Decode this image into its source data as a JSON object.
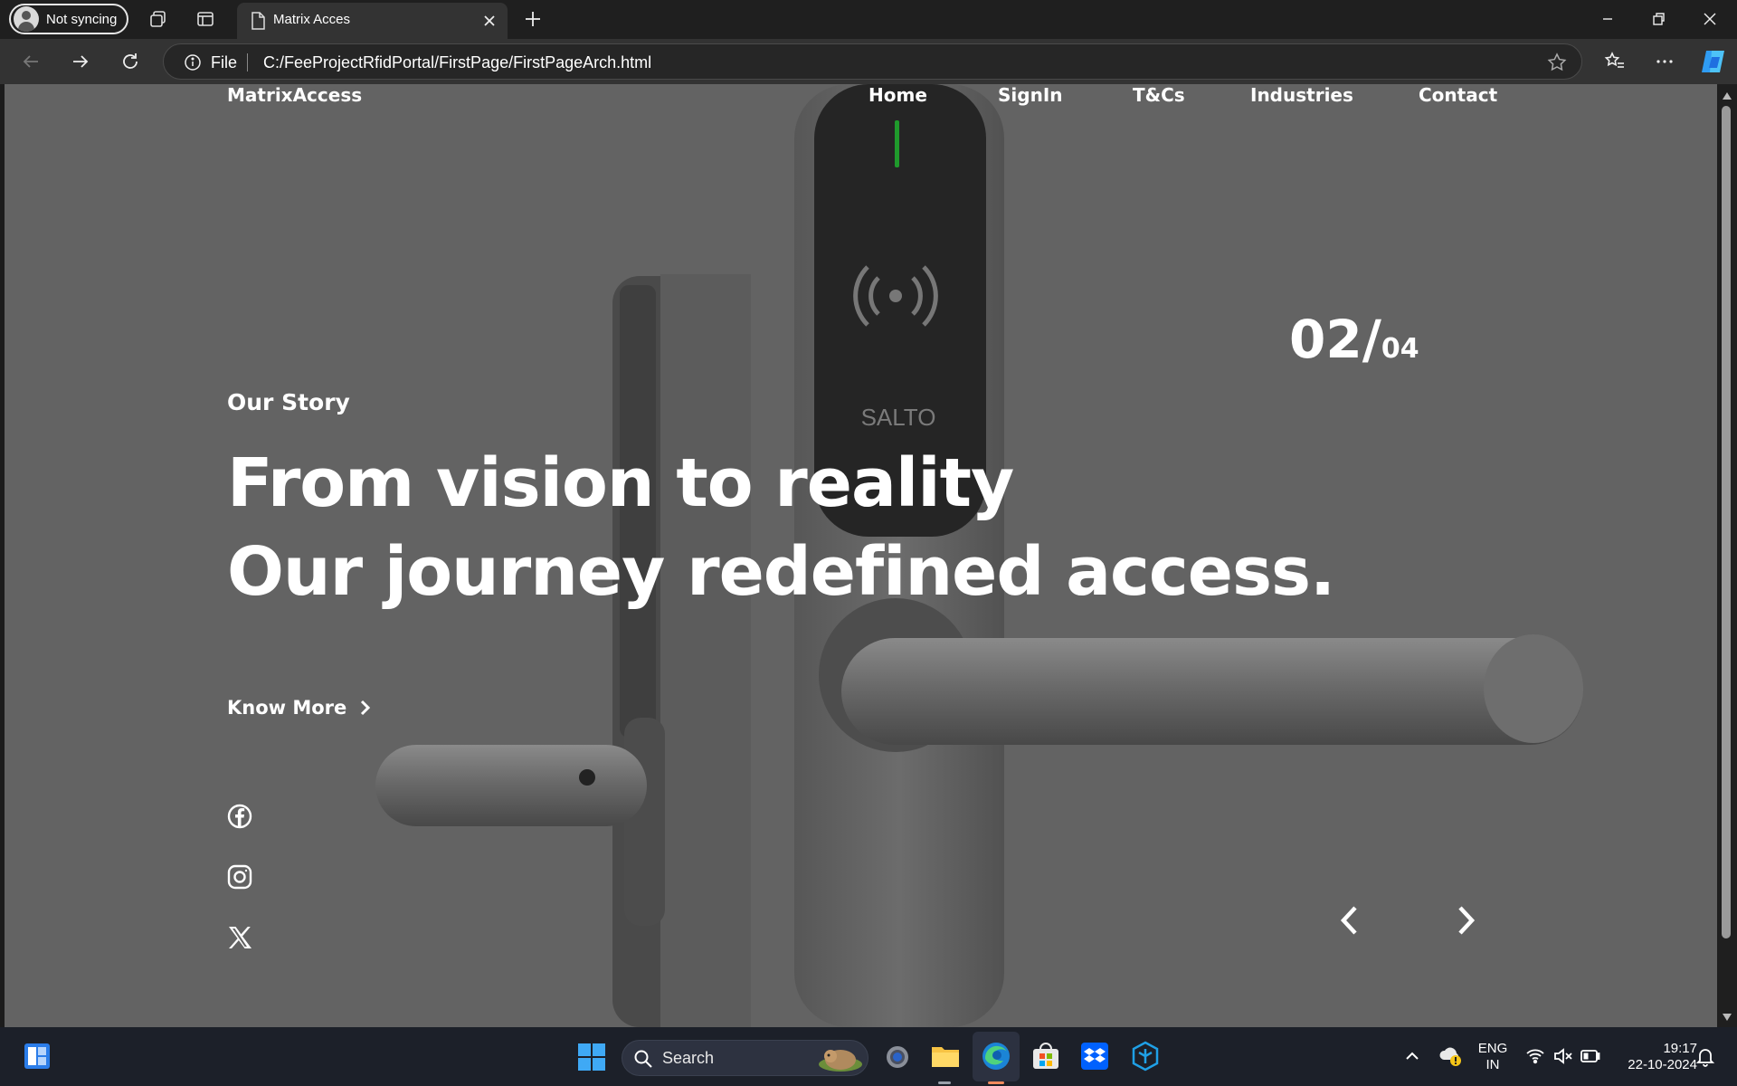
{
  "browser": {
    "profile_label": "Not syncing",
    "tab_title": "Matrix Acces",
    "file_label": "File",
    "url": "C:/FeeProjectRfidPortal/FirstPage/FirstPageArch.html"
  },
  "site": {
    "brand": "MatrixAccess",
    "nav": [
      "Home",
      "SignIn",
      "T&Cs",
      "Industries",
      "Contact"
    ],
    "eyebrow": "Our Story",
    "headline_line1": "From vision to reality",
    "headline_line2": "Our journey redefined access.",
    "slide_current": "02/",
    "slide_total": "04",
    "cta": "Know More",
    "product_text": "SALTO",
    "social": [
      "facebook-icon",
      "instagram-icon",
      "x-icon"
    ]
  },
  "taskbar": {
    "search_label": "Search",
    "lang_line1": "ENG",
    "lang_line2": "IN",
    "time": "19:17",
    "date": "22-10-2024"
  }
}
